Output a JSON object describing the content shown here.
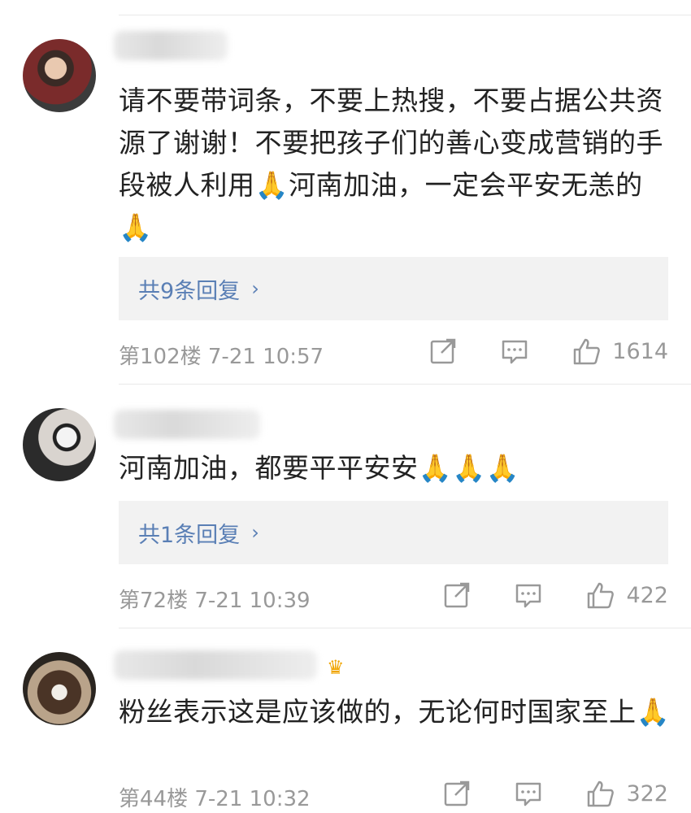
{
  "comments": [
    {
      "text": "请不要带词条，不要上热搜，不要占据公共资源了谢谢！不要把孩子们的善心变成营销的手段被人利用🙏河南加油，一定会平安无恙的🙏",
      "replies_label": "共9条回复",
      "floor_time": "第102楼  7-21 10:57",
      "likes": "1614"
    },
    {
      "text": "河南加油，都要平平安安🙏🙏🙏",
      "replies_label": "共1条回复",
      "floor_time": "第72楼  7-21 10:39",
      "likes": "422"
    },
    {
      "text": "粉丝表示这是应该做的，无论何时国家至上🙏",
      "floor_time": "第44楼  7-21 10:32",
      "likes": "322"
    }
  ],
  "icons": {
    "share": "share-icon",
    "comment": "comment-icon",
    "like": "thumbs-up-icon",
    "fan_badge": "crown-badge-icon"
  },
  "colors": {
    "link": "#5a7fb5",
    "reply_bg": "#f2f2f2",
    "meta": "#999999"
  }
}
